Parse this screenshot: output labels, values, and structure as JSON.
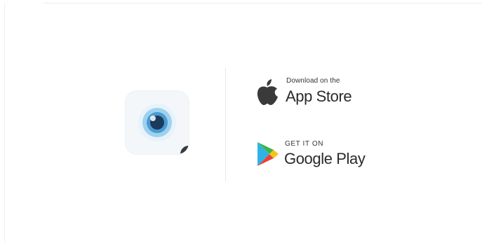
{
  "app": {
    "icon": "eye-icon"
  },
  "badges": {
    "app_store": {
      "small_text": "Download on the",
      "large_text": "App Store",
      "icon": "apple-logo-icon"
    },
    "google_play": {
      "small_text": "GET IT ON",
      "large_text": "Google Play",
      "icon": "google-play-logo-icon"
    }
  },
  "colors": {
    "eye_iris_outer": "#9fd1ef",
    "eye_iris_inner": "#4a9bd0",
    "eye_pupil": "#1b3a5c",
    "apple_logo": "#3a3a3a"
  }
}
